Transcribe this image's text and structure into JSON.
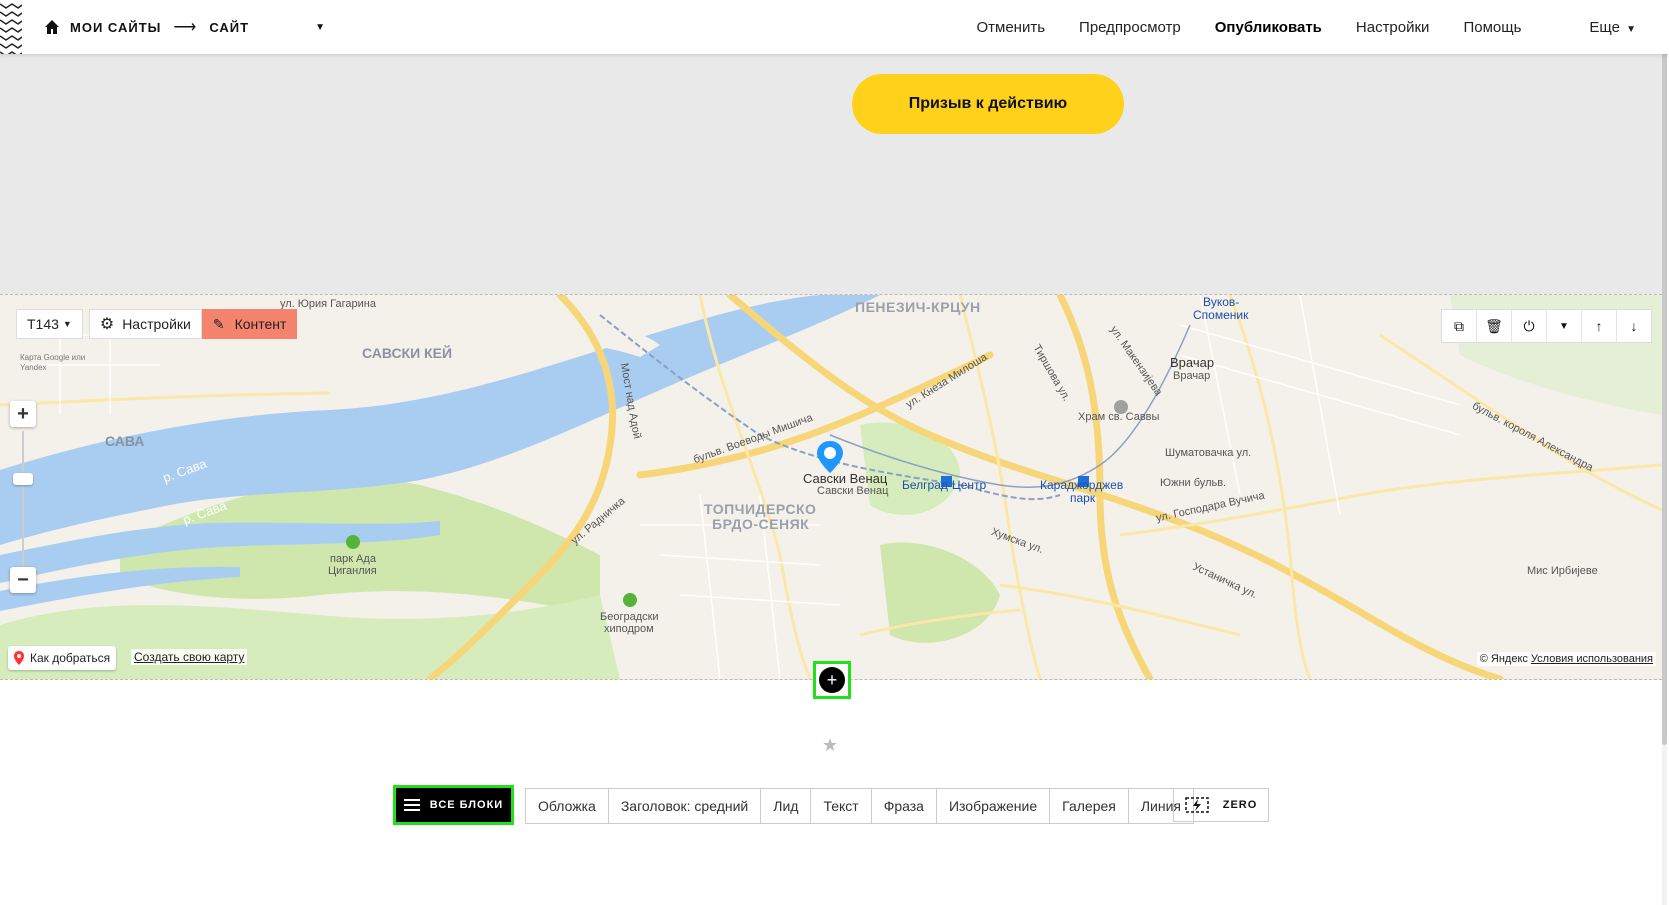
{
  "header": {
    "crumb_root": "МОИ САЙТЫ",
    "crumb_arrow": "⟶",
    "crumb_site": "САЙТ",
    "nav": {
      "cancel": "Отменить",
      "preview": "Предпросмотр",
      "publish": "Опубликовать",
      "settings": "Настройки",
      "help": "Помощь",
      "more": "Еще"
    }
  },
  "cta": {
    "label": "Призыв к действию",
    "color": "#ffd11a"
  },
  "map_block": {
    "block_id": "T143",
    "settings_label": "Настройки",
    "content_label": "Контент",
    "google_note": "Карта Google или Yandex",
    "route_label": "Как добраться",
    "create_map": "Создать свою карту",
    "copyright": "© Яндекс",
    "terms": "Условия использования",
    "labels": {
      "savski_kej": "САВСКИ КЕЙ",
      "sava": "САВА",
      "river1": "р. Сава",
      "river2": "р. Сава",
      "penezic": "ПЕНЕЗИЧ-КРЦУН",
      "topcider": "ТОПЧИДЕРСКО",
      "brdo": "БРДО-СЕНЯК",
      "savski_venac": "Савски Венац",
      "savski_venac_small": "Савски Венац",
      "beograd_centar": "Белград-Центр",
      "karadjordjev": "Караджорджев",
      "park": "парк",
      "vracar": "Врачар",
      "vracar_small": "Врачар",
      "hram": "Храм св. Саввы",
      "vukov": "Вуков-",
      "spomenik": "Споменик",
      "ada1": "парк Ада",
      "ada2": "Циганлия",
      "hippo1": "Београдски",
      "hippo2": "хиподром",
      "mis_irbijeve": "Мис Ирбијеве",
      "bulv_vojvode": "бульв. Воеводы Мишича",
      "ul_radnicka": "ул. Радничка",
      "ul_knjaza": "ул. Кнеза Милоша",
      "ul_juriya": "ул. Юрия Гагарина",
      "most": "Мост над Адой",
      "ul_hum": "Хумска ул.",
      "ul_gospodara": "ул. Господара Вучича",
      "ul_ustanicka": "Устаничка ул.",
      "bulv_kralja": "бульв. короля Александра",
      "juzhni": "Южни бульв.",
      "ul_tirsova": "Тиршова ул.",
      "ul_makenzijeva": "ул. Макензијева",
      "ul_sumatovacka": "Шуматовачка ул."
    }
  },
  "library": {
    "all_blocks": "ВСЕ БЛОКИ",
    "categories": [
      "Обложка",
      "Заголовок: средний",
      "Лид",
      "Текст",
      "Фраза",
      "Изображение",
      "Галерея",
      "Линия"
    ],
    "zero": "ZERO"
  },
  "colors": {
    "highlight": "#22e01c",
    "content_btn": "#f4846d",
    "water": "#a9cdf0",
    "park": "#c8e6a5",
    "road": "#f7d67a"
  }
}
